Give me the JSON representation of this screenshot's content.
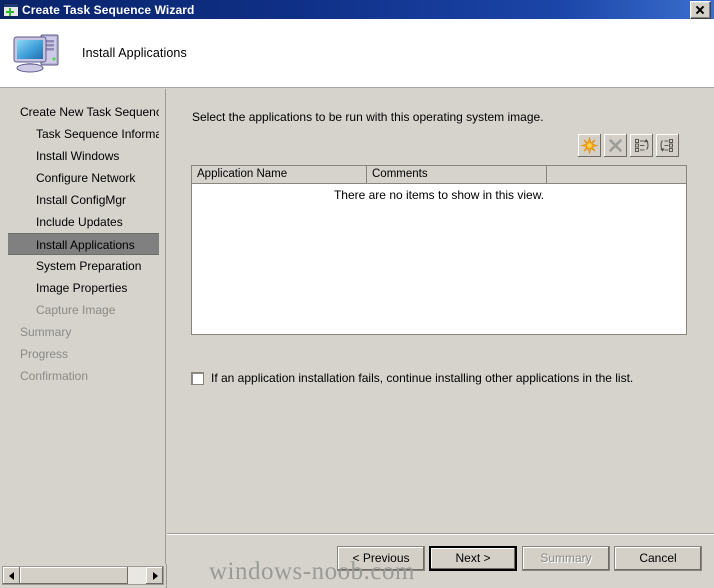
{
  "window": {
    "title": "Create Task Sequence Wizard",
    "icon": "wizard-window-plus-icon",
    "close_label": "Close"
  },
  "header": {
    "title": "Install Applications",
    "icon": "computer-icon"
  },
  "sidebar": {
    "items": [
      {
        "label": "Create New Task Sequence",
        "indent": false,
        "state": "normal"
      },
      {
        "label": "Task Sequence Informatio",
        "indent": true,
        "state": "normal"
      },
      {
        "label": "Install Windows",
        "indent": true,
        "state": "normal"
      },
      {
        "label": "Configure Network",
        "indent": true,
        "state": "normal"
      },
      {
        "label": "Install ConfigMgr",
        "indent": true,
        "state": "normal"
      },
      {
        "label": "Include Updates",
        "indent": true,
        "state": "normal"
      },
      {
        "label": "Install Applications",
        "indent": true,
        "state": "active"
      },
      {
        "label": "System Preparation",
        "indent": true,
        "state": "normal"
      },
      {
        "label": "Image Properties",
        "indent": true,
        "state": "normal"
      },
      {
        "label": "Capture Image",
        "indent": true,
        "state": "disabled"
      },
      {
        "label": "Summary",
        "indent": false,
        "state": "disabled"
      },
      {
        "label": "Progress",
        "indent": false,
        "state": "disabled"
      },
      {
        "label": "Confirmation",
        "indent": false,
        "state": "disabled"
      }
    ],
    "scrollbar": {
      "left_arrow": "scroll-left-icon",
      "right_arrow": "scroll-right-icon"
    }
  },
  "content": {
    "instruction": "Select the applications to be run with this operating system image.",
    "toolbar": [
      {
        "name": "new-application-button",
        "icon": "starburst-icon",
        "enabled": true
      },
      {
        "name": "delete-application-button",
        "icon": "x-delete-icon",
        "enabled": false
      },
      {
        "name": "move-up-button",
        "icon": "list-move-up-icon",
        "enabled": true
      },
      {
        "name": "move-down-button",
        "icon": "list-move-down-icon",
        "enabled": true
      }
    ],
    "list": {
      "columns": [
        "Application Name",
        "Comments",
        ""
      ],
      "rows": [],
      "empty_message": "There are no items to show in this view."
    },
    "checkbox": {
      "label": "If an application installation fails, continue installing other applications in the list.",
      "checked": false
    }
  },
  "footer": {
    "buttons": [
      {
        "label": "< Previous",
        "state": "normal"
      },
      {
        "label": "Next >",
        "state": "default"
      },
      {
        "label": "Summary",
        "state": "disabled"
      },
      {
        "label": "Cancel",
        "state": "normal"
      }
    ]
  },
  "watermark": {
    "text": "windows-noob.com"
  },
  "colors": {
    "titlebar_start": "#0a246a",
    "titlebar_end": "#3a6fce",
    "dialog_face": "#d6d3cd",
    "button_face": "#d4d0c8",
    "selection": "#808080",
    "accent_star": "#f2a714",
    "disabled_text": "#8a8a86"
  }
}
